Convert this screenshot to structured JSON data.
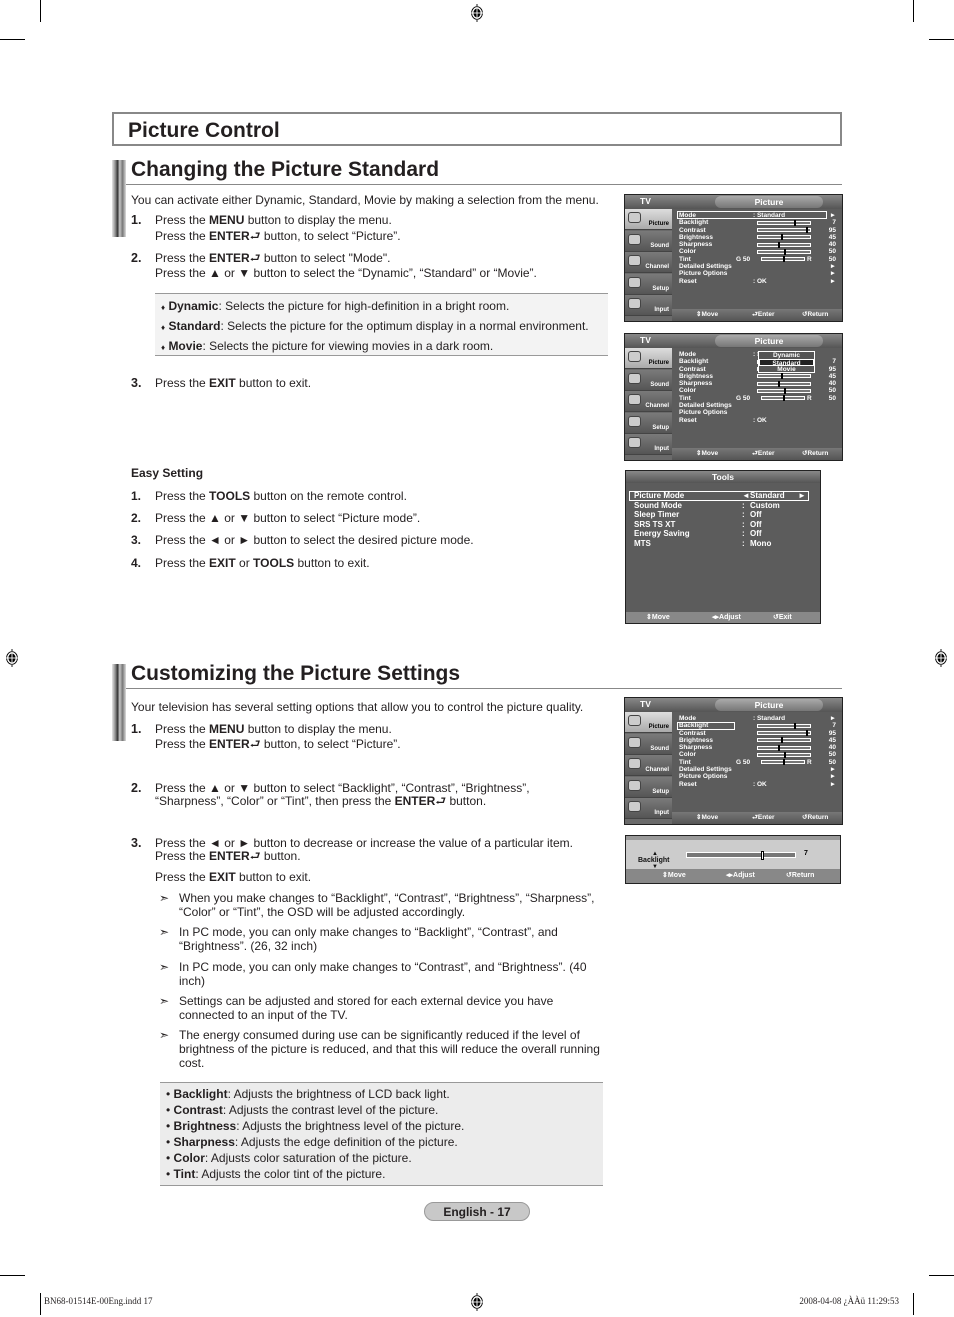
{
  "page": {
    "title": "Picture Control",
    "page_label": "English - 17",
    "footer_file": "BN68-01514E-00Eng.indd   17",
    "footer_timestamp": "2008-04-08   ¿ÀÀü 11:29:53"
  },
  "section1": {
    "title": "Changing the Picture Standard",
    "intro": "You can activate either Dynamic, Standard, Movie by making a selection from the menu.",
    "steps": [
      {
        "num": "1.",
        "line1_pre": "Press the ",
        "line1_bold": "MENU",
        "line1_post": " button to display the menu.",
        "line2_pre": "Press the ",
        "line2_bold": "ENTER",
        "line2_post": " button, to select “Picture”."
      },
      {
        "num": "2.",
        "line1_pre": "Press the ",
        "line1_bold": "ENTER",
        "line1_post": " button to select \"Mode\".",
        "line2": "Press the ▲ or ▼ button to select the “Dynamic”, “Standard” or “Movie”."
      },
      {
        "num": "3.",
        "line1_pre": "Press the ",
        "line1_bold": "EXIT",
        "line1_post": " button to exit."
      }
    ],
    "modes": [
      {
        "name": "Dynamic",
        "desc": ": Selects the picture for high-definition in a bright room."
      },
      {
        "name": "Standard",
        "desc": ": Selects the picture for the optimum display in a normal environment."
      },
      {
        "name": "Movie",
        "desc": ": Selects the picture for viewing movies in a dark room."
      }
    ],
    "bullet": "♦"
  },
  "easy_setting": {
    "title": "Easy Setting",
    "steps": [
      {
        "num": "1.",
        "pre": "Press the ",
        "bold": "TOOLS",
        "post": " button on the remote control."
      },
      {
        "num": "2.",
        "text": "Press the ▲ or ▼ button to select “Picture mode”."
      },
      {
        "num": "3.",
        "text": "Press the ◄ or ► button to select the desired picture mode."
      },
      {
        "num": "4.",
        "pre": "Press the ",
        "bold": "EXIT",
        "mid": " or ",
        "bold2": "TOOLS",
        "post": " button to exit."
      }
    ]
  },
  "section2": {
    "title": "Customizing the Picture Settings",
    "intro": "Your television has several setting options that allow you to control the picture quality.",
    "step1": {
      "num": "1.",
      "line1_pre": "Press the ",
      "line1_bold": "MENU",
      "line1_post": " button to display the menu.",
      "line2_pre": "Press the ",
      "line2_bold": "ENTER",
      "line2_post": " button, to select “Picture”."
    },
    "step2": {
      "num": "2.",
      "line1": "Press the ▲ or ▼ button to select “Backlight”, “Contrast”, “Brightness”,",
      "line2_pre": "“Sharpness”, “Color” or “Tint”, then press the ",
      "line2_bold": "ENTER",
      "line2_post": " button."
    },
    "step3": {
      "num": "3.",
      "line1": "Press the ◄ or ► button to decrease or increase the value of a particular item.",
      "line2_pre": "Press the ",
      "line2_bold": "ENTER",
      "line2_post": " button.",
      "line3_pre": "Press the ",
      "line3_bold": "EXIT",
      "line3_post": " button to exit."
    },
    "notes": [
      "When you make changes to “Backlight”, “Contrast”, “Brightness”, “Sharpness”, “Color” or “Tint”, the OSD will be adjusted accordingly.",
      "In PC mode, you can only make changes to “Backlight”, “Contrast”, and “Brightness”. (26, 32 inch)",
      "In PC mode, you can only make changes to “Contrast”, and “Brightness”. (40 inch)",
      "Settings can be adjusted and stored for each external device you have connected to an input of the TV.",
      "The energy consumed during use can be significantly reduced if the level of brightness of the picture is reduced, and that this will reduce the overall running cost."
    ],
    "note_marker": "➣",
    "definitions": [
      {
        "name": "Backlight",
        "desc": ": Adjusts the brightness of LCD back light."
      },
      {
        "name": "Contrast",
        "desc": ": Adjusts the contrast level of the picture."
      },
      {
        "name": "Brightness",
        "desc": ": Adjusts the brightness level of the picture."
      },
      {
        "name": "Sharpness",
        "desc": ": Adjusts the edge definition  of the picture."
      },
      {
        "name": "Color",
        "desc": ": Adjusts color saturation of the picture."
      },
      {
        "name": "Tint",
        "desc": ": Adjusts the color tint of the picture."
      }
    ],
    "def_bullet": "•"
  },
  "osd_picture": {
    "tv_label": "TV",
    "title": "Picture",
    "sidebar": [
      "Picture",
      "Sound",
      "Channel",
      "Setup",
      "Input"
    ],
    "rows": [
      {
        "name": "Mode",
        "value": ": Standard",
        "arrow": "►"
      },
      {
        "name": "Backlight",
        "num": "7",
        "level": 7,
        "max": 10
      },
      {
        "name": "Contrast",
        "num": "95",
        "level": 95,
        "max": 100
      },
      {
        "name": "Brightness",
        "num": "45",
        "level": 45,
        "max": 100
      },
      {
        "name": "Sharpness",
        "num": "40",
        "level": 40,
        "max": 100
      },
      {
        "name": "Color",
        "num": "50",
        "level": 50,
        "max": 100
      },
      {
        "name": "Tint",
        "left": "G  50",
        "right": "R",
        "num": "50",
        "level": 50,
        "max": 100
      },
      {
        "name": "Detailed Settings",
        "arrow": "►"
      },
      {
        "name": "Picture Options",
        "arrow": "►"
      },
      {
        "name": "Reset",
        "value": ": OK",
        "arrow": "►"
      }
    ],
    "footer": {
      "move": "Move",
      "enter": "Enter",
      "return": "Return"
    },
    "dropdown": [
      "Dynamic",
      "Standard",
      "Movie"
    ],
    "dropdown_selected": "Standard"
  },
  "osd_tools": {
    "title": "Tools",
    "rows": [
      {
        "name": "Picture Mode",
        "sep": "◄",
        "value": "Standard",
        "arrow": "►"
      },
      {
        "name": "Sound Mode",
        "sep": ":",
        "value": "Custom"
      },
      {
        "name": "Sleep Timer",
        "sep": ":",
        "value": "Off"
      },
      {
        "name": "SRS TS XT",
        "sep": ":",
        "value": "Off"
      },
      {
        "name": "Energy Saving",
        "sep": ":",
        "value": "Off"
      },
      {
        "name": "MTS",
        "sep": ":",
        "value": "Mono"
      }
    ],
    "footer": {
      "move": "Move",
      "adjust": "Adjust",
      "exit": "Exit"
    }
  },
  "osd_backlight": {
    "label": "Backlight",
    "value": "7",
    "level": 7,
    "max": 10,
    "footer": {
      "move": "Move",
      "adjust": "Adjust",
      "return": "Return"
    }
  }
}
